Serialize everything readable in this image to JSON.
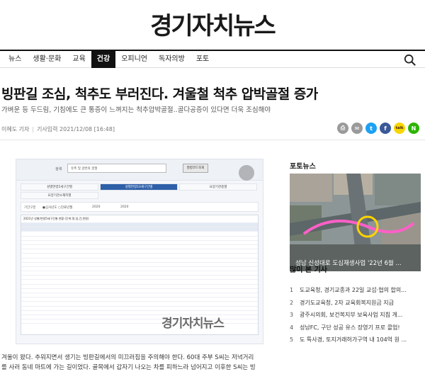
{
  "site": {
    "logo": "경기자치뉴스"
  },
  "nav": {
    "items": [
      "뉴스",
      "생활·문화",
      "교육",
      "건강",
      "오피니언",
      "독자의방",
      "포토"
    ],
    "active_index": 3
  },
  "article": {
    "title": "빙판길 조심, 척추도 부러진다. 겨울철 척추 압박골절 증가",
    "subtitle": "가벼운 등 두드림, 기침에도 큰 통증이 느껴지는 척추압박골절..골다공증이 있다면 더욱 조심해야",
    "author": "이혜도 기자",
    "date": "기사입력 2021/12/08 [16:48]",
    "image_watermark": "경기자치뉴스",
    "body": [
      "겨울이 왔다. 추워지면서 생기는 빙판길에서의 미끄러짐을 주의해야 한다. 60대 주부 S씨는 저녁거리",
      "를 사러 동네 마트에 가는 길이었다. 골목에서 갑자기 나오는 차를 피하느라 넘어지고 이후한 S씨는 빙"
    ]
  },
  "article_image": {
    "search_label": "검색",
    "search_value": "유추 및 글번의 골절",
    "search_button": "질병코드조회",
    "tabs": [
      "성별연령5세구간별",
      "성별연령10세구간별",
      "요양기관종별",
      "요양기관소재지별"
    ],
    "active_tab": 1,
    "filter_label": "기간구분",
    "filter_options": "●심사년도 ○진료년월",
    "year_from": "2020",
    "year_to": "2020",
    "table_caption": "2021년 성별/연령5세구간별 현황 (단위:명,일,건,천원)"
  },
  "share": {
    "buttons": [
      {
        "name": "print-icon",
        "color": "#9a9a9a",
        "glyph": "⎙"
      },
      {
        "name": "email-icon",
        "color": "#9a9a9a",
        "glyph": "✉"
      },
      {
        "name": "twitter-icon",
        "color": "#1da1f2",
        "glyph": "t"
      },
      {
        "name": "facebook-icon",
        "color": "#3b5998",
        "glyph": "f"
      },
      {
        "name": "kakaotalk-icon",
        "color": "#f7d600",
        "glyph": "talk"
      },
      {
        "name": "naver-icon",
        "color": "#2db400",
        "glyph": "N"
      }
    ]
  },
  "sidebar": {
    "photo_news_heading": "포토뉴스",
    "photo_caption": "성남 신성대로 도심재생사업 '22년 6월 ...",
    "most_read_heading": "많이 본 기사",
    "most_read": [
      "도교육청, 경기교종과 22일 교섭·협의 합의...",
      "경기도교육청, 2차 교육회복지원금 지급",
      "광주시의회, 보건복지부 보육사업 지침 개...",
      "성남FC, 구단 성공 유스 장영기 프로 콜업!",
      "도 특사경, 토지거래허가구역 내 104억 원 ..."
    ]
  }
}
